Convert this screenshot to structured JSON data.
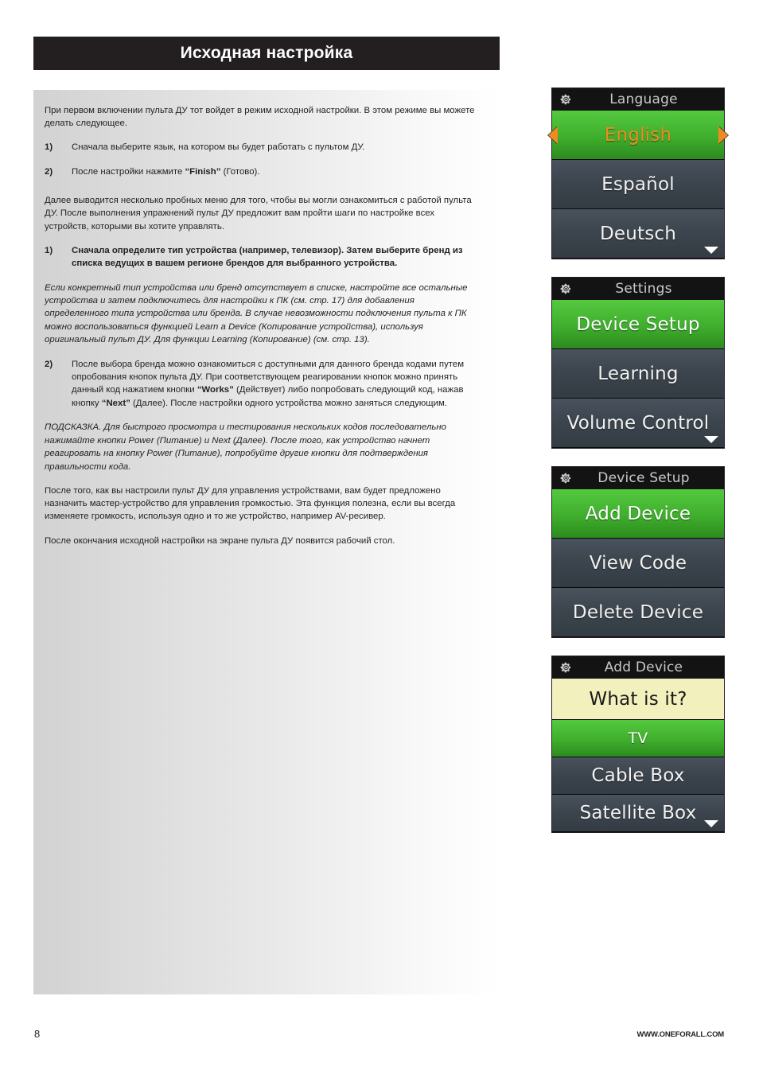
{
  "page": {
    "title": "Исходная настройка",
    "number": "8",
    "url": "WWW.ONEFORALL.COM"
  },
  "body": {
    "intro": "При первом включении пульта ДУ тот войдет в режим исходной настройки. В этом режиме вы можете делать следующее.",
    "list1": [
      {
        "num": "1)",
        "text": "Сначала выберите язык, на котором вы будет работать с пультом ДУ."
      },
      {
        "num": "2)",
        "text_before": "После настройки нажмите ",
        "bold": "“Finish”",
        "text_after": " (Готово)."
      }
    ],
    "para2": "Далее выводится несколько пробных меню для того, чтобы вы могли ознакомиться с работой пульта ДУ. После выполнения упражнений пульт ДУ предложит вам пройти шаги по настройке всех устройств, которыми вы хотите управлять.",
    "list2_item1": {
      "num": "1)",
      "text": "Сначала определите тип устройства (например, телевизор). Затем выберите бренд из списка ведущих в вашем регионе брендов для выбранного устройства."
    },
    "italic1": "Если конкретный тип устройства или бренд отсутствует в списке, настройте все остальные устройства и затем подключитесь для настройки к ПК (см. стр. 17) для добавления определенного типа устройства или бренда. В случае невозможности подключения пульта к ПК можно воспользоваться функцией Learn a Device (Копирование устройства), используя оригинальный пульт ДУ. Для функции Learning (Копирование) (см. стр. 13).",
    "list2_item2": {
      "num": "2)",
      "p1": "После выбора бренда можно ознакомиться с доступными для данного бренда кодами путем опробования кнопок пульта ДУ. При соответствующем реагировании кнопок можно принять данный код нажатием кнопки ",
      "b1": "“Works”",
      "p2": " (Действует) либо попробовать следующий код, нажав кнопку ",
      "b2": "“Next”",
      "p3": " (Далее). После настройки одного устройства можно заняться следующим."
    },
    "italic2": "ПОДСКАЗКА. Для быстрого просмотра и тестирования нескольких кодов последовательно нажимайте кнопки Power (Питание) и Next (Далее). После того, как устройство начнет реагировать на кнопку Power (Питание), попробуйте другие кнопки для подтверждения правильности кода.",
    "para3": "После того, как вы настроили пульт ДУ для управления устройствами, вам будет предложено назначить мастер-устройство для управления громкостью. Эта функция полезна, если вы всегда изменяете громкость, используя одно и то же устройство, например AV-ресивер.",
    "para4": "После окончания исходной настройки на экране пульта ДУ появится рабочий стол."
  },
  "screens": [
    {
      "title": "Language",
      "icon": "gear-icon",
      "has_scroll_caret": true,
      "rows": [
        {
          "label": "English",
          "style": "green",
          "selected": true,
          "arrows": true
        },
        {
          "label": "Español",
          "style": "dark"
        },
        {
          "label": "Deutsch",
          "style": "dark"
        }
      ]
    },
    {
      "title": "Settings",
      "icon": "gear-icon",
      "has_scroll_caret": true,
      "rows": [
        {
          "label": "Device Setup",
          "style": "green"
        },
        {
          "label": "Learning",
          "style": "dark"
        },
        {
          "label": "Volume Control",
          "style": "dark"
        }
      ]
    },
    {
      "title": "Device Setup",
      "icon": "gear-icon",
      "has_scroll_caret": false,
      "rows": [
        {
          "label": "Add Device",
          "style": "green"
        },
        {
          "label": "View Code",
          "style": "dark"
        },
        {
          "label": "Delete Device",
          "style": "dark"
        }
      ]
    },
    {
      "title": "Add Device",
      "icon": "gear-icon",
      "has_scroll_caret": true,
      "rows": [
        {
          "label": "What is it?",
          "style": "cream"
        },
        {
          "label": "TV",
          "style": "green",
          "small": true
        },
        {
          "label": "Cable Box",
          "style": "dark"
        },
        {
          "label": "Satellite Box",
          "style": "dark"
        }
      ]
    }
  ],
  "colors": {
    "header_bg": "#231f20",
    "accent_green": "#3fae2d",
    "accent_orange": "#f08a22",
    "row_dark": "#3c444d",
    "row_cream": "#f2f0bd"
  }
}
